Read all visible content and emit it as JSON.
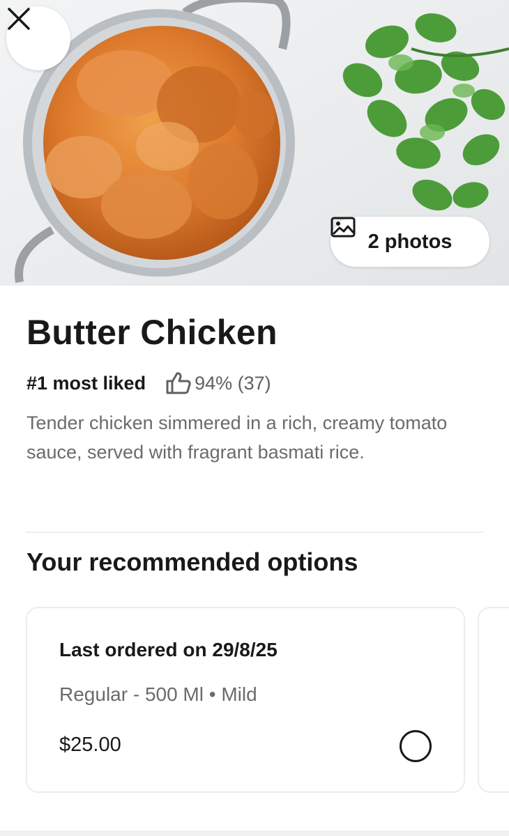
{
  "item": {
    "name": "Butter Chicken",
    "rank_label": "#1 most liked",
    "rating_text": "94% (37)",
    "description": "Tender chicken simmered in a rich, creamy tomato sauce, served with fragrant basmati rice."
  },
  "photos_button": {
    "label": "2 photos",
    "icon": "image-icon"
  },
  "close_button": {
    "icon": "close-icon"
  },
  "recommended": {
    "title": "Your recommended options",
    "options": [
      {
        "heading": "Last ordered on 29/8/25",
        "detail": "Regular - 500 Ml • Mild",
        "price": "$25.00",
        "selected": false
      }
    ]
  },
  "colors": {
    "text_primary": "#191919",
    "text_secondary": "#6b6b6b",
    "curry": "#d9782f"
  }
}
